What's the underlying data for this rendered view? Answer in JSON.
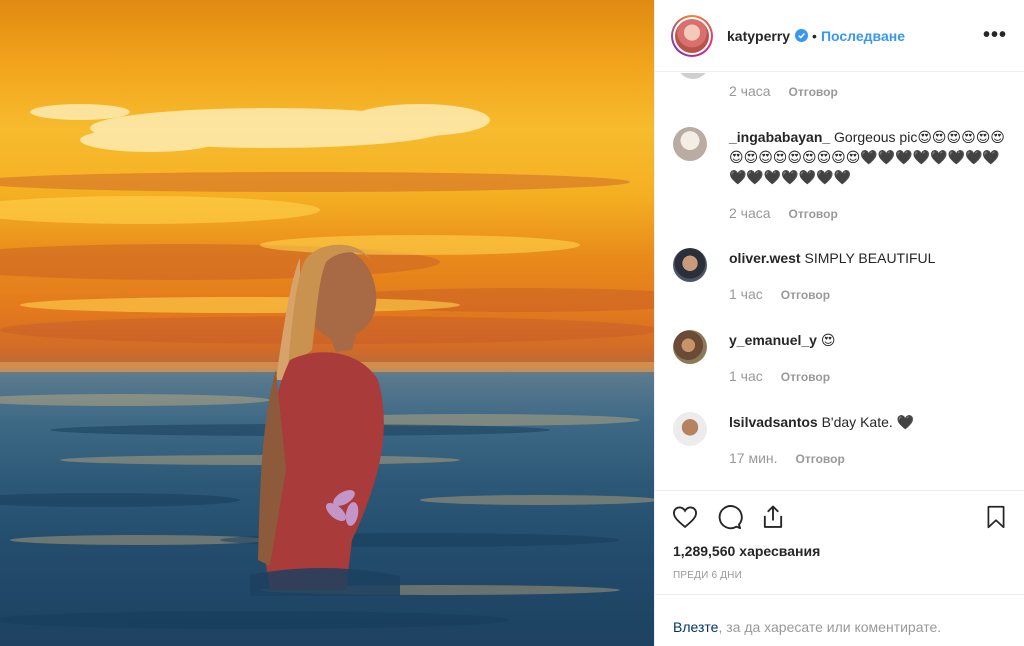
{
  "header": {
    "username": "katyperry",
    "separator": "•",
    "follow_label": "Последване",
    "more_label": "•••"
  },
  "comments": [
    {
      "time": "2 часа",
      "reply": "Отговор"
    },
    {
      "user": "_ingababayan_",
      "text": "Gorgeous pic😍😍😍😍😍😍😍😍😍😍😍😍😍😍😍🖤🖤🖤🖤🖤🖤🖤🖤🖤🖤🖤🖤🖤🖤🖤",
      "time": "2 часа",
      "reply": "Отговор"
    },
    {
      "user": "oliver.west",
      "text": "SIMPLY BEAUTIFUL",
      "time": "1 час",
      "reply": "Отговор"
    },
    {
      "user": "y_emanuel_y",
      "text": "😍",
      "time": "1 час",
      "reply": "Отговор"
    },
    {
      "user": "lsilvadsantos",
      "text": "B'day Kate. 🖤",
      "time": "17 мин.",
      "reply": "Отговор"
    }
  ],
  "actions": {
    "likes_count": "1,289,560",
    "likes_label": "харесвания",
    "posted": "преди 6 дни"
  },
  "login": {
    "link": "Влезте",
    "text": ", за да харесате или коментирате."
  },
  "icons": [
    "heart-icon",
    "comment-icon",
    "share-icon",
    "bookmark-icon",
    "verified-icon",
    "more-options-icon"
  ],
  "colors": {
    "follow": "#3897f0",
    "verified": "#3897f0",
    "muted": "#999999",
    "link": "#003569"
  }
}
